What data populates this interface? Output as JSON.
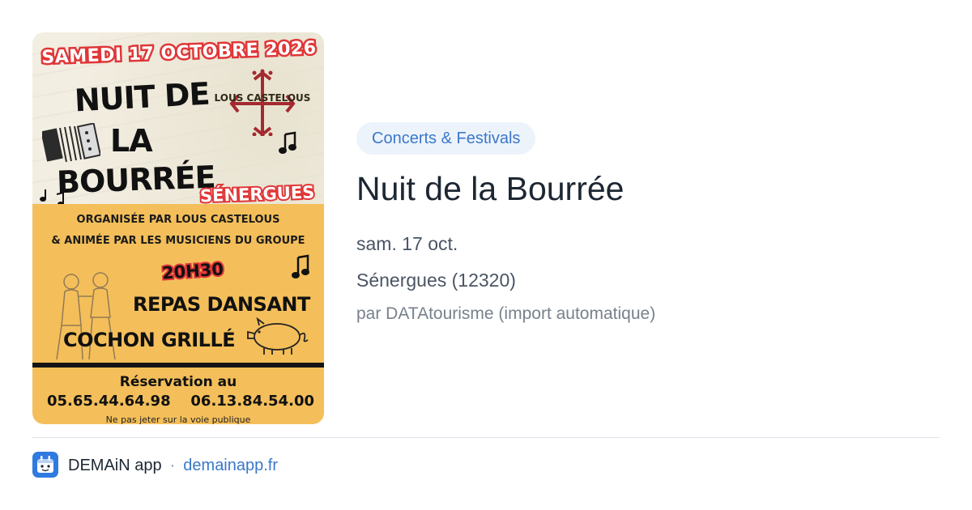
{
  "poster": {
    "date_banner": "SAMEDI 17 OCTOBRE 2026",
    "title_line1": "NUIT DE",
    "title_line2": "LA",
    "title_line3": "BOURRÉE",
    "logo_text": "LOUS CASTELOUS",
    "town": "SÉNERGUES",
    "organised_by": "ORGANISÉE PAR LOUS CASTELOUS",
    "animated_by": "& ANIMÉE PAR LES MUSICIENS DU GROUPE",
    "hour": "20H30",
    "meal_line1": "REPAS DANSANT",
    "meal_line2": "COCHON GRILLÉ",
    "reservation_label": "Réservation au",
    "phones": [
      "05.65.44.64.98",
      "06.13.84.54.00"
    ],
    "notice": "Ne pas jeter sur la voie publique"
  },
  "event": {
    "category": "Concerts & Festivals",
    "title": "Nuit de la Bourrée",
    "date": "sam. 17 oct.",
    "place": "Sénergues (12320)",
    "source": "par DATAtourisme (import automatique)"
  },
  "footer": {
    "app_name": "DEMAiN app",
    "separator": "·",
    "link": "demainapp.fr"
  },
  "colors": {
    "accent": "#3a78c9",
    "pill_bg": "#edf3fb",
    "poster_red": "#e03638",
    "poster_yellow": "#f4bf5a"
  },
  "icons": {
    "app": "demain-app-icon",
    "accordion": "accordion-icon",
    "pig": "pig-icon",
    "cross": "occitan-cross-icon",
    "note": "music-note-icon"
  }
}
